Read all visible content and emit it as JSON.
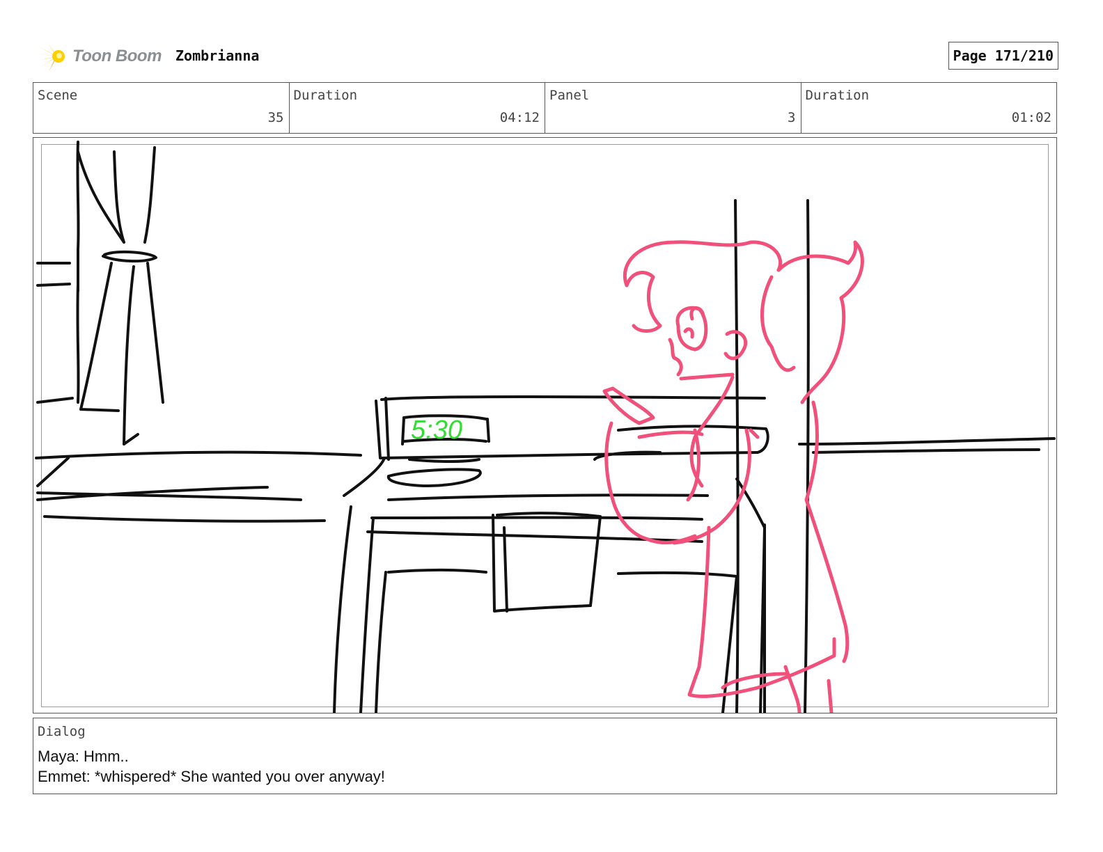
{
  "header": {
    "logo_text": "Toon Boom",
    "project_title": "Zombrianna",
    "page_label": "Page",
    "page_number": "171/210"
  },
  "info": [
    {
      "label": "Scene",
      "value": "35"
    },
    {
      "label": "Duration",
      "value": "04:12"
    },
    {
      "label": "Panel",
      "value": "3"
    },
    {
      "label": "Duration",
      "value": "01:02"
    }
  ],
  "panel": {
    "clock_text": "5:30",
    "colors": {
      "line": "#111111",
      "character": "#f0507a",
      "clock": "#33dd33"
    }
  },
  "dialog": {
    "label": "Dialog",
    "lines": [
      "Maya: Hmm..",
      "Emmet: *whispered* She wanted you over anyway!"
    ]
  },
  "colors": {
    "logo_orange": "#f6a800",
    "logo_text": "#8a8f94",
    "border": "#555555"
  }
}
